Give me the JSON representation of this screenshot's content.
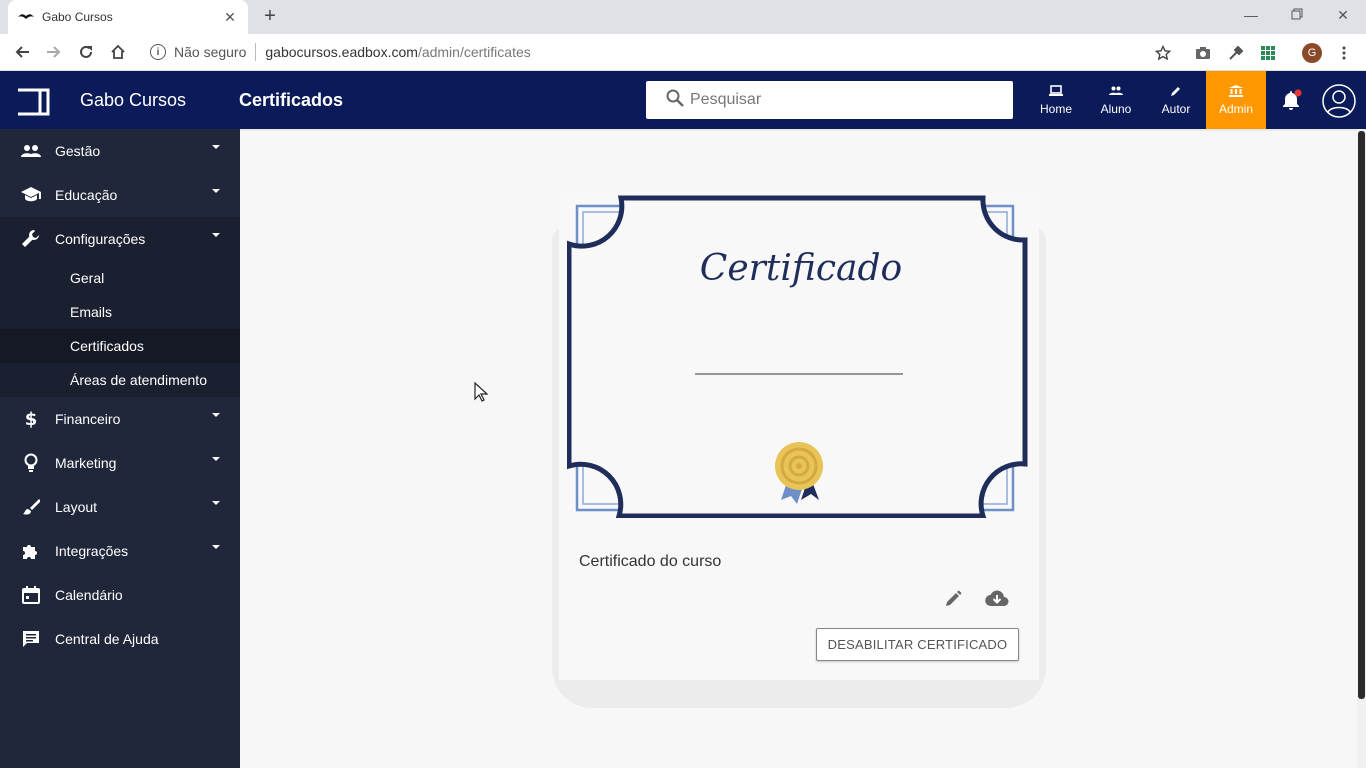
{
  "browser": {
    "tab_title": "Gabo Cursos",
    "security_label": "Não seguro",
    "url_host": "gabocursos.eadbox.com",
    "url_path": "/admin/certificates",
    "profile_initial": "G"
  },
  "header": {
    "brand": "Gabo Cursos",
    "page_title": "Certificados",
    "search_placeholder": "Pesquisar",
    "nav": [
      {
        "label": "Home",
        "icon": "laptop-icon"
      },
      {
        "label": "Aluno",
        "icon": "people-icon"
      },
      {
        "label": "Autor",
        "icon": "pencil-icon"
      },
      {
        "label": "Admin",
        "icon": "bank-icon",
        "active": true
      }
    ],
    "accent_color": "#ff9800",
    "bar_color": "#0b1a58"
  },
  "sidebar": {
    "items": [
      {
        "label": "Gestão",
        "icon": "people-icon"
      },
      {
        "label": "Educação",
        "icon": "school-icon"
      },
      {
        "label": "Configurações",
        "icon": "wrench-icon"
      },
      {
        "label": "Financeiro",
        "icon": "dollar-icon"
      },
      {
        "label": "Marketing",
        "icon": "lightbulb-icon"
      },
      {
        "label": "Layout",
        "icon": "brush-icon"
      },
      {
        "label": "Integrações",
        "icon": "puzzle-icon"
      },
      {
        "label": "Calendário",
        "icon": "calendar-icon"
      },
      {
        "label": "Central de Ajuda",
        "icon": "chat-icon"
      }
    ],
    "sub_items": [
      "Geral",
      "Emails",
      "Certificados",
      "Áreas de atendimento"
    ]
  },
  "main": {
    "certificate_heading": "Certificado",
    "card_title": "Certificado do curso",
    "disable_button": "DESABILITAR CERTIFICADO"
  }
}
